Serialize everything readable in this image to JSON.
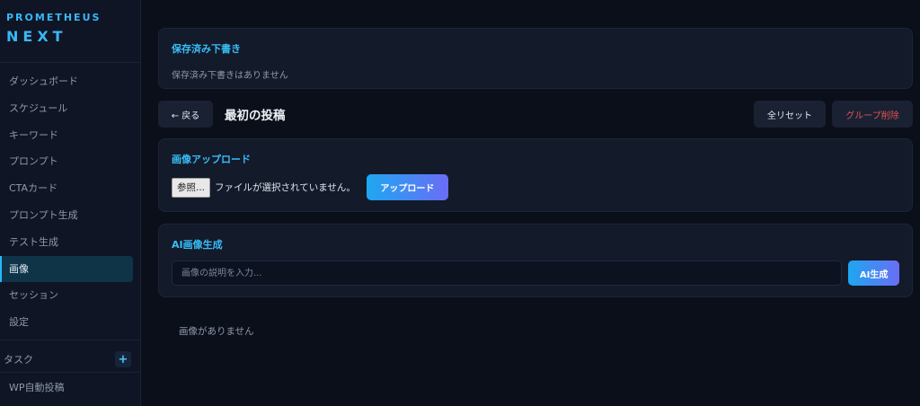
{
  "brand": {
    "line1": "PROMETHEUS",
    "line2": "NEXT"
  },
  "sidebar": {
    "items": [
      {
        "label": "ダッシュボード"
      },
      {
        "label": "スケジュール"
      },
      {
        "label": "キーワード"
      },
      {
        "label": "プロンプト"
      },
      {
        "label": "CTAカード"
      },
      {
        "label": "プロンプト生成"
      },
      {
        "label": "テスト生成"
      },
      {
        "label": "画像",
        "active": true
      },
      {
        "label": "セッション"
      },
      {
        "label": "設定"
      }
    ],
    "task_section": {
      "label": "タスク",
      "add_symbol": "+"
    },
    "task_items": [
      {
        "label": "WP自動投稿"
      }
    ]
  },
  "drafts": {
    "title": "保存済み下書き",
    "empty_text": "保存済み下書きはありません"
  },
  "header": {
    "back_label": "← 戻る",
    "title": "最初の投稿",
    "reset_label": "全リセット",
    "delete_label": "グループ削除"
  },
  "upload": {
    "title": "画像アップロード",
    "browse_label": "参照...",
    "file_status": "ファイルが選択されていません。",
    "button_label": "アップロード"
  },
  "ai_generate": {
    "title": "AI画像生成",
    "placeholder": "画像の説明を入力...",
    "button_label": "AI生成"
  },
  "gallery": {
    "empty_text": "画像がありません"
  },
  "colors": {
    "accent": "#38bdf8",
    "danger": "#e05252",
    "background": "#0b0f1a"
  }
}
